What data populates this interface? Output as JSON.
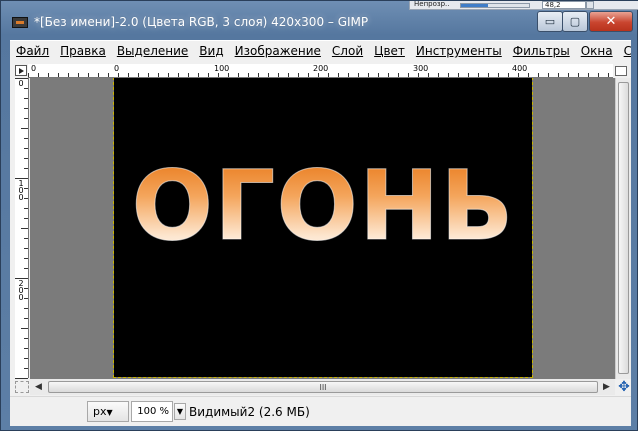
{
  "window": {
    "title": "*[Без имени]-2.0 (Цвета RGB, 3 слоя) 420x300 – GIMP",
    "minimize_symbol": "▭",
    "maximize_symbol": "▢",
    "close_symbol": "✕"
  },
  "float_panel": {
    "opacity_label": "Непрозр..",
    "opacity_value": "48,2"
  },
  "menubar": {
    "items": [
      "Файл",
      "Правка",
      "Выделение",
      "Вид",
      "Изображение",
      "Слой",
      "Цвет",
      "Инструменты",
      "Фильтры",
      "Окна",
      "Справка"
    ]
  },
  "rulers": {
    "horizontal_labels": [
      "0",
      "0",
      "100",
      "200",
      "300",
      "400"
    ],
    "vertical_labels": [
      "0",
      "100",
      "200"
    ]
  },
  "canvas": {
    "text": "ОГОНЬ",
    "background": "#000000",
    "fill_top": "#e8791a",
    "fill_bottom": "#fff8f0"
  },
  "scrollbar": {
    "grip": "III"
  },
  "statusbar": {
    "unit": "px",
    "zoom": "100 %",
    "info": "Видимый2 (2.6 МБ)"
  }
}
